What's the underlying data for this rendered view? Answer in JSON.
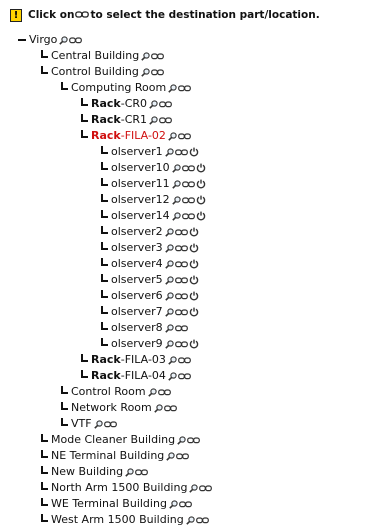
{
  "header": {
    "warning_icon_text": "!",
    "text_before": "Click on",
    "text_after": "to select the destination part/location."
  },
  "tree": [
    {
      "label": "Virgo",
      "depth": 0,
      "toggle": true
    },
    {
      "label": "Central Building",
      "depth": 1
    },
    {
      "label": "Control Building",
      "depth": 1
    },
    {
      "label": "Computing Room",
      "depth": 2
    },
    {
      "prefix": "Rack",
      "label": "-CR0",
      "depth": 3
    },
    {
      "prefix": "Rack",
      "label": "-CR1",
      "depth": 3
    },
    {
      "prefix": "Rack",
      "label": "-FILA-02",
      "depth": 3,
      "highlight": true
    },
    {
      "label": "olserver1",
      "depth": 4,
      "power": true
    },
    {
      "label": "olserver10",
      "depth": 4,
      "power": true
    },
    {
      "label": "olserver11",
      "depth": 4,
      "power": true
    },
    {
      "label": "olserver12",
      "depth": 4,
      "power": true
    },
    {
      "label": "olserver14",
      "depth": 4,
      "power": true
    },
    {
      "label": "olserver2",
      "depth": 4,
      "power": true
    },
    {
      "label": "olserver3",
      "depth": 4,
      "power": true
    },
    {
      "label": "olserver4",
      "depth": 4,
      "power": true
    },
    {
      "label": "olserver5",
      "depth": 4,
      "power": true
    },
    {
      "label": "olserver6",
      "depth": 4,
      "power": true
    },
    {
      "label": "olserver7",
      "depth": 4,
      "power": true
    },
    {
      "label": "olserver8",
      "depth": 4,
      "power": false
    },
    {
      "label": "olserver9",
      "depth": 4,
      "power": true
    },
    {
      "prefix": "Rack",
      "label": "-FILA-03",
      "depth": 3
    },
    {
      "prefix": "Rack",
      "label": "-FILA-04",
      "depth": 3
    },
    {
      "label": "Control Room",
      "depth": 2
    },
    {
      "label": "Network Room",
      "depth": 2
    },
    {
      "label": "VTF",
      "depth": 2
    },
    {
      "label": "Mode Cleaner Building",
      "depth": 1
    },
    {
      "label": "NE Terminal Building",
      "depth": 1
    },
    {
      "label": "New Building",
      "depth": 1
    },
    {
      "label": "North Arm 1500 Building",
      "depth": 1
    },
    {
      "label": "WE Terminal Building",
      "depth": 1
    },
    {
      "label": "West Arm 1500 Building",
      "depth": 1
    }
  ],
  "icons": {
    "select": "link-icon",
    "info": "magnifier-icon",
    "power": "power-icon"
  },
  "colors": {
    "highlight": "#d01010",
    "warning": "#ffd400"
  }
}
